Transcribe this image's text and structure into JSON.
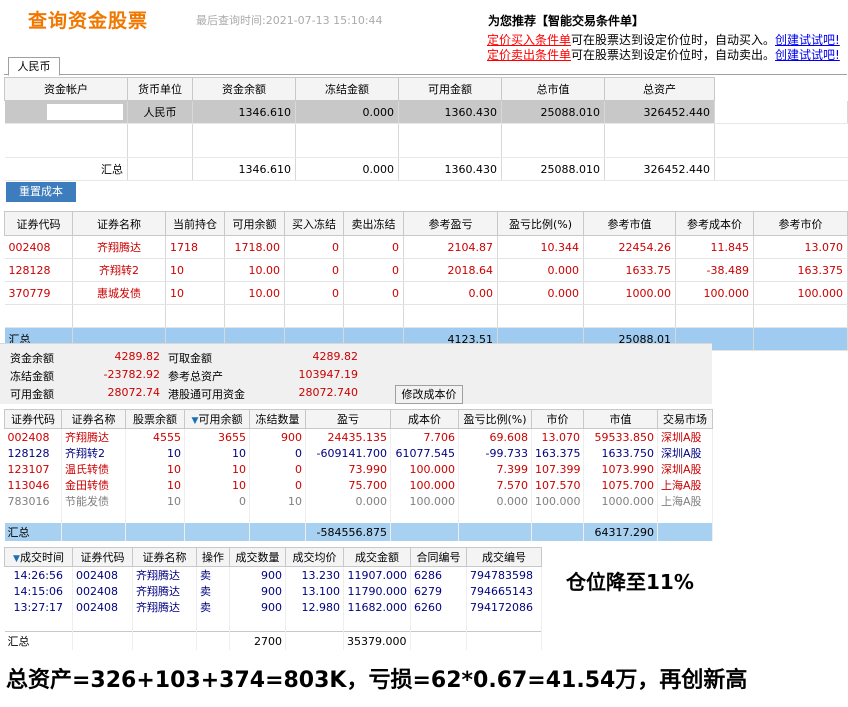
{
  "header": {
    "title": "查询资金股票",
    "last_query": "最后查询时间:2021-07-13 15:10:44"
  },
  "recommend": {
    "title": "为您推荐【智能交易条件单】",
    "buy": {
      "link": "定价买入条件单",
      "text": "可在股票达到设定价位时，自动买入。",
      "create": "创建试试吧!"
    },
    "sell": {
      "link": "定价卖出条件单",
      "text": "可在股票达到设定价位时，自动卖出。",
      "create": "创建试试吧!"
    }
  },
  "currency_tab": "人民币",
  "funds": {
    "headers": [
      "资金帐户",
      "货币单位",
      "资金余额",
      "冻结金额",
      "可用金额",
      "总市值",
      "总资产"
    ],
    "row": {
      "account": "",
      "unit": "人民币",
      "balance": "1346.610",
      "frozen": "0.000",
      "available": "1360.430",
      "market_value": "25088.010",
      "total": "326452.440"
    },
    "total": {
      "label": "汇总",
      "balance": "1346.610",
      "frozen": "0.000",
      "available": "1360.430",
      "market_value": "25088.010",
      "total": "326452.440"
    }
  },
  "reset_cost_button": "重置成本",
  "positions": {
    "headers": [
      "证券代码",
      "证券名称",
      "当前持仓",
      "可用余额",
      "买入冻结",
      "卖出冻结",
      "参考盈亏",
      "盈亏比例(%)",
      "参考市值",
      "参考成本价",
      "参考市价"
    ],
    "rows": [
      [
        "002408",
        "齐翔腾达",
        "1718",
        "1718.00",
        "0",
        "0",
        "2104.87",
        "10.344",
        "22454.26",
        "11.845",
        "13.070"
      ],
      [
        "128128",
        "齐翔转2",
        "10",
        "10.00",
        "0",
        "0",
        "2018.64",
        "0.000",
        "1633.75",
        "-38.489",
        "163.375"
      ],
      [
        "370779",
        "惠城发债",
        "10",
        "10.00",
        "0",
        "0",
        "0.00",
        "0.000",
        "1000.00",
        "100.000",
        "100.000"
      ]
    ],
    "total": {
      "label": "汇总",
      "profit": "4123.51",
      "market_value": "25088.01"
    }
  },
  "summary": {
    "fund_balance_label": "资金余额",
    "fund_balance": "4289.82",
    "withdrawable_label": "可取金额",
    "withdrawable": "4289.82",
    "frozen_label": "冻结金额",
    "frozen": "-23782.92",
    "ref_total_label": "参考总资产",
    "ref_total": "103947.19",
    "available_label": "可用金额",
    "available": "28072.74",
    "hk_available_label": "港股通可用资金",
    "hk_available": "28072.740",
    "modify_cost_button": "修改成本价"
  },
  "positions2": {
    "headers": [
      "证券代码",
      "证券名称",
      "股票余额",
      "可用余额",
      "冻结数量",
      "盈亏",
      "成本价",
      "盈亏比例(%)",
      "市价",
      "市值",
      "交易市场"
    ],
    "rows": [
      [
        "002408",
        "齐翔腾达",
        "4555",
        "3655",
        "900",
        "24435.135",
        "7.706",
        "69.608",
        "13.070",
        "59533.850",
        "深圳A股"
      ],
      [
        "128128",
        "齐翔转2",
        "10",
        "10",
        "0",
        "-609141.700",
        "61077.545",
        "-99.733",
        "163.375",
        "1633.750",
        "深圳A股"
      ],
      [
        "123107",
        "温氏转债",
        "10",
        "10",
        "0",
        "73.990",
        "100.000",
        "7.399",
        "107.399",
        "1073.990",
        "深圳A股"
      ],
      [
        "113046",
        "金田转债",
        "10",
        "10",
        "0",
        "75.700",
        "100.000",
        "7.570",
        "107.570",
        "1075.700",
        "上海A股"
      ],
      [
        "783016",
        "节能发债",
        "10",
        "0",
        "10",
        "0.000",
        "100.000",
        "0.000",
        "100.000",
        "1000.000",
        "上海A股"
      ]
    ],
    "total": {
      "label": "汇总",
      "profit": "-584556.875",
      "market_value": "64317.290"
    }
  },
  "trades": {
    "headers": [
      "成交时间",
      "证券代码",
      "证券名称",
      "操作",
      "成交数量",
      "成交均价",
      "成交金额",
      "合同编号",
      "成交编号"
    ],
    "rows": [
      [
        "14:26:56",
        "002408",
        "齐翔腾达",
        "卖",
        "900",
        "13.230",
        "11907.000",
        "6286",
        "794783598"
      ],
      [
        "14:15:06",
        "002408",
        "齐翔腾达",
        "卖",
        "900",
        "13.100",
        "11790.000",
        "6279",
        "794665143"
      ],
      [
        "13:27:17",
        "002408",
        "齐翔腾达",
        "卖",
        "900",
        "12.980",
        "11682.000",
        "6260",
        "794172086"
      ]
    ],
    "total": {
      "label": "汇总",
      "qty": "2700",
      "amount": "35379.000"
    }
  },
  "annotation_position": "仓位降至11%",
  "annotation_total": "总资产=326+103+374=803K，亏损=62*0.67=41.54万，再创新高",
  "colors": {
    "title": "#f07800",
    "highlight": "#9fcbf0",
    "loss": "#cc0000",
    "button": "#3d7dbd"
  }
}
